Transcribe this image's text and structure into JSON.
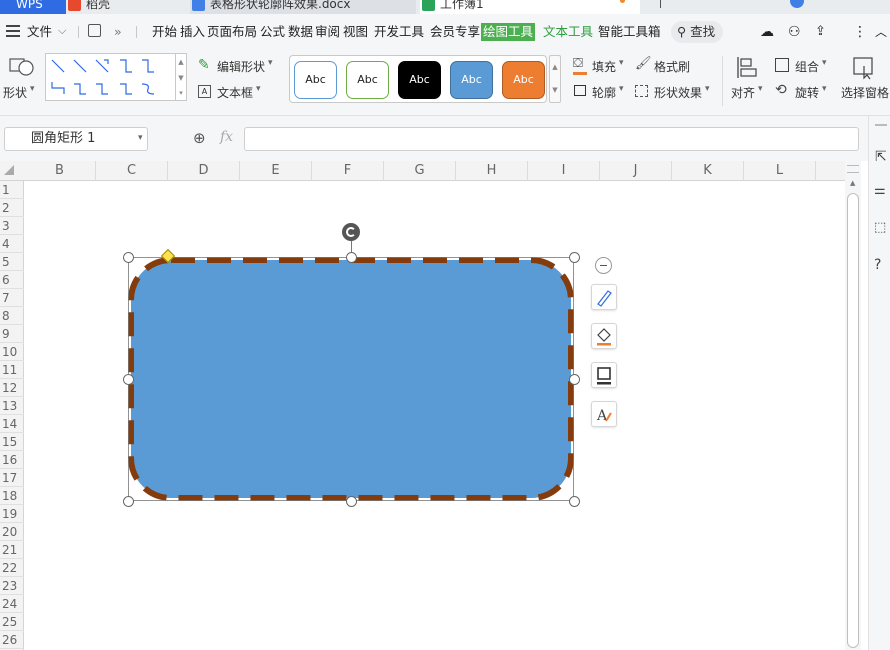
{
  "title_tabs": {
    "wps": "WPS",
    "daoke": "稻壳",
    "doc": "表格形状轮廓阵效果.docx",
    "book": "工作簿1"
  },
  "menu": {
    "file": "文件",
    "items": [
      "开始",
      "插入",
      "页面布局",
      "公式",
      "数据",
      "审阅",
      "视图",
      "开发工具",
      "会员专享",
      "绘图工具",
      "文本工具",
      "智能工具箱"
    ],
    "active": "绘图工具",
    "search": "查找"
  },
  "ribbon": {
    "shape_label": "形状",
    "edit_shape": "编辑形状",
    "text_box": "文本框",
    "style_presets": [
      {
        "label": "Abc",
        "fill": "#ffffff",
        "border": "#5b9bd5",
        "text": "#222222"
      },
      {
        "label": "Abc",
        "fill": "#ffffff",
        "border": "#70ad47",
        "text": "#222222"
      },
      {
        "label": "Abc",
        "fill": "#000000",
        "border": "#000000",
        "text": "#ffffff"
      },
      {
        "label": "Abc",
        "fill": "#5b9bd5",
        "border": "#41719c",
        "text": "#ffffff"
      },
      {
        "label": "Abc",
        "fill": "#ed7d31",
        "border": "#ae5a21",
        "text": "#ffffff"
      }
    ],
    "fill": "填充",
    "format_painter": "格式刷",
    "outline": "轮廓",
    "shape_effects": "形状效果",
    "align": "对齐",
    "group": "组合",
    "rotate": "旋转",
    "selection_pane": "选择窗格"
  },
  "formula_bar": {
    "name_box": "圆角矩形 1",
    "fx": "fx",
    "value": ""
  },
  "columns": [
    "B",
    "C",
    "D",
    "E",
    "F",
    "G",
    "H",
    "I",
    "J",
    "K",
    "L"
  ],
  "rows": [
    "1",
    "2",
    "3",
    "4",
    "5",
    "6",
    "7",
    "8",
    "9",
    "10",
    "11",
    "12",
    "13",
    "14",
    "15",
    "16",
    "17",
    "18",
    "19",
    "20",
    "21",
    "22",
    "23",
    "24",
    "25",
    "26"
  ],
  "shape": {
    "name": "圆角矩形 1",
    "fill": "#5b9bd5",
    "outline_color": "#843c0c",
    "outline_style": "dashed"
  },
  "colors": {
    "accent_green": "#4caf50",
    "wps_blue": "#2f6be3"
  }
}
